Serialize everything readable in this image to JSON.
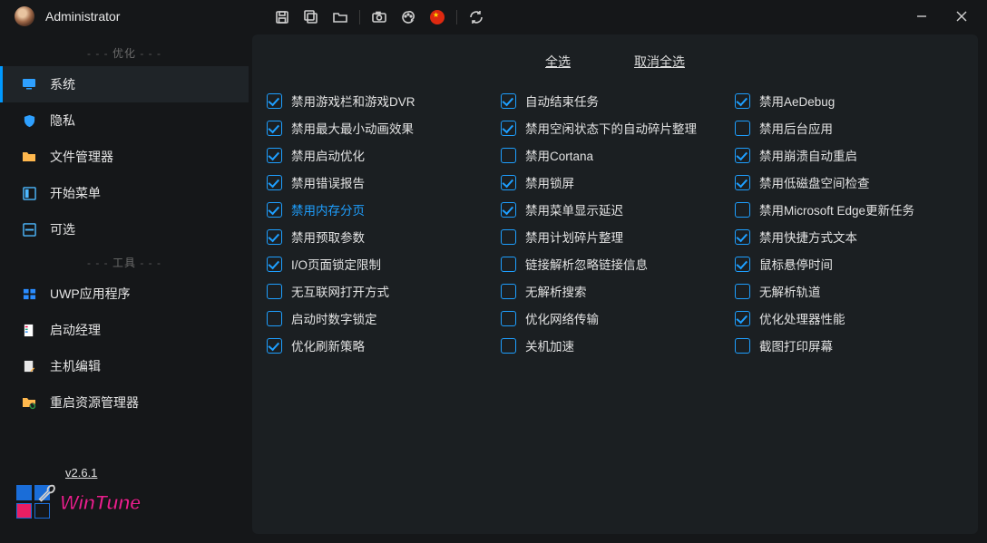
{
  "user": "Administrator",
  "version": "v2.6.1",
  "logo_text": "WinTune",
  "sections": {
    "optimize": "优化",
    "tools": "工具"
  },
  "nav": {
    "system": "系统",
    "privacy": "隐私",
    "fileManager": "文件管理器",
    "startMenu": "开始菜单",
    "optional": "可选",
    "uwp": "UWP应用程序",
    "launchMgr": "启动经理",
    "hostEdit": "主机编辑",
    "restartExp": "重启资源管理器"
  },
  "actions": {
    "selectAll": "全选",
    "deselectAll": "取消全选"
  },
  "cols": [
    [
      {
        "l": "禁用游戏栏和游戏DVR",
        "c": true
      },
      {
        "l": "禁用最大最小动画效果",
        "c": true
      },
      {
        "l": "禁用启动优化",
        "c": true
      },
      {
        "l": "禁用错误报告",
        "c": true
      },
      {
        "l": "禁用内存分页",
        "c": true,
        "hl": true
      },
      {
        "l": "禁用预取参数",
        "c": true
      },
      {
        "l": "I/O页面锁定限制",
        "c": true
      },
      {
        "l": "无互联网打开方式",
        "c": false
      },
      {
        "l": "启动时数字锁定",
        "c": false
      },
      {
        "l": "优化刷新策略",
        "c": true
      }
    ],
    [
      {
        "l": "自动结束任务",
        "c": true
      },
      {
        "l": "禁用空闲状态下的自动碎片整理",
        "c": true
      },
      {
        "l": "禁用Cortana",
        "c": false
      },
      {
        "l": "禁用锁屏",
        "c": true
      },
      {
        "l": "禁用菜单显示延迟",
        "c": true
      },
      {
        "l": "禁用计划碎片整理",
        "c": false
      },
      {
        "l": "链接解析忽略链接信息",
        "c": false
      },
      {
        "l": "无解析搜索",
        "c": false
      },
      {
        "l": "优化网络传输",
        "c": false
      },
      {
        "l": "关机加速",
        "c": false
      }
    ],
    [
      {
        "l": "禁用AeDebug",
        "c": true
      },
      {
        "l": "禁用后台应用",
        "c": false
      },
      {
        "l": "禁用崩溃自动重启",
        "c": true
      },
      {
        "l": "禁用低磁盘空间检查",
        "c": true
      },
      {
        "l": "禁用Microsoft Edge更新任务",
        "c": false
      },
      {
        "l": "禁用快捷方式文本",
        "c": true
      },
      {
        "l": "鼠标悬停时间",
        "c": true
      },
      {
        "l": "无解析轨道",
        "c": false
      },
      {
        "l": "优化处理器性能",
        "c": true
      },
      {
        "l": "截图打印屏幕",
        "c": false
      }
    ]
  ]
}
